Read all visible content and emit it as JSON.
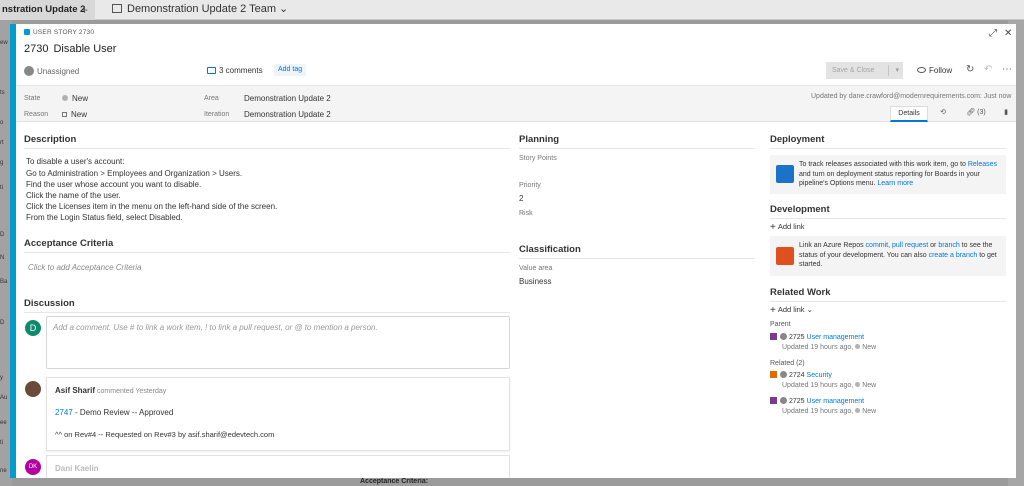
{
  "background": {
    "team_tab": "nstration Update 2",
    "board_title": "Demonstration Update 2 Team",
    "bottom_label": "Acceptance Criteria:",
    "left_labels": [
      "ew",
      "ts",
      "o",
      "rt",
      "g",
      "ti",
      "D",
      "N",
      "Ba",
      "D",
      "y",
      "Au",
      "ee",
      "ti",
      "ne"
    ]
  },
  "header": {
    "type_label": "USER STORY 2730",
    "id": "2730",
    "title": "Disable User",
    "assigned": "Unassigned",
    "comments": "3 comments",
    "add_tag": "Add tag",
    "save_close": "Save & Close",
    "follow": "Follow",
    "expand_icon": "expand-icon",
    "close_icon": "close-icon"
  },
  "fields": {
    "state_label": "State",
    "state_value": "New",
    "reason_label": "Reason",
    "reason_value": "New",
    "area_label": "Area",
    "area_value": "Demonstration Update 2",
    "iteration_label": "Iteration",
    "iteration_value": "Demonstration Update 2",
    "updated": "Updated by dane.crawford@modernrequirements.com: Just now",
    "tabs": [
      "Details",
      "",
      "(3)",
      ""
    ]
  },
  "description": {
    "title": "Description",
    "lines": [
      "To disable a user's account:",
      "Go to Administration > Employees and Organization > Users.",
      "Find the user whose account you want to disable.",
      "Click the name of the user.",
      "Click the Licenses item in the menu on the left-hand side of the screen.",
      "From the Login Status field, select Disabled."
    ]
  },
  "acceptance": {
    "title": "Acceptance Criteria",
    "placeholder": "Click to add Acceptance Criteria"
  },
  "discussion": {
    "title": "Discussion",
    "avatar_letter": "D",
    "placeholder": "Add a comment. Use # to link a work item, ! to link a pull request, or @ to mention a person.",
    "comment": {
      "author": "Asif Sharif",
      "when": "commented Yesterday",
      "link_id": "2747",
      "link_text": " - Demo Review -- Approved",
      "line2": "^^ on Rev#4 -- Requested on Rev#3 by asif.sharif@edevtech.com"
    },
    "comment2_author": "Dani Kaelin",
    "comment2_avatar": "DK"
  },
  "planning": {
    "title": "Planning",
    "story_points_label": "Story Points",
    "priority_label": "Priority",
    "priority_value": "2",
    "risk_label": "Risk"
  },
  "classification": {
    "title": "Classification",
    "value_area_label": "Value area",
    "value_area_value": "Business"
  },
  "deployment": {
    "title": "Deployment",
    "text_a": "To track releases associated with this work item, go to ",
    "link_releases": "Releases",
    "text_b": " and turn on deployment status reporting for Boards in your pipeline's Options menu. ",
    "link_learn": "Learn more"
  },
  "development": {
    "title": "Development",
    "add_link": "Add link",
    "text_a": "Link an Azure Repos ",
    "link_commit": "commit",
    "sep1": ", ",
    "link_pr": "pull request",
    "sep2": " or ",
    "link_branch": "branch",
    "text_b": " to see the status of your development. You can also ",
    "link_create": "create a branch",
    "text_c": " to get started."
  },
  "related_work": {
    "title": "Related Work",
    "add_link": "Add link",
    "parent_label": "Parent",
    "parent_id": "2725",
    "parent_title": "User management",
    "parent_meta": "Updated 19 hours ago,",
    "parent_state": "New",
    "related_label": "Related (2)",
    "items": [
      {
        "id": "2724",
        "title": "Security",
        "meta": "Updated 19 hours ago,",
        "state": "New"
      },
      {
        "id": "2725",
        "title": "User management",
        "meta": "Updated 19 hours ago,",
        "state": "New"
      }
    ]
  },
  "colors": {
    "accent": "#009ccc",
    "link": "#0078d4",
    "avatar_d": "#0f8a6e",
    "avatar_dk": "#b4009e"
  }
}
